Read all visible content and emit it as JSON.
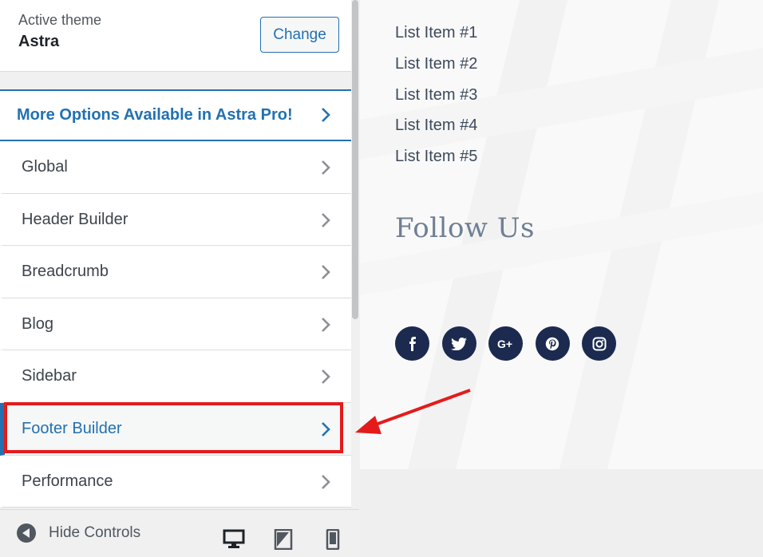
{
  "theme": {
    "label": "Active theme",
    "name": "Astra",
    "change_label": "Change"
  },
  "menu": {
    "pro_label": "More Options Available in Astra Pro!",
    "items": [
      {
        "label": "Global"
      },
      {
        "label": "Header Builder"
      },
      {
        "label": "Breadcrumb"
      },
      {
        "label": "Blog"
      },
      {
        "label": "Sidebar"
      },
      {
        "label": "Footer Builder"
      },
      {
        "label": "Performance"
      }
    ],
    "active_item": "Footer Builder"
  },
  "footer": {
    "hide_controls": "Hide Controls",
    "devices": [
      "desktop-icon",
      "tablet-icon",
      "mobile-icon"
    ]
  },
  "preview": {
    "list": [
      "List Item #1",
      "List Item #2",
      "List Item #3",
      "List Item #4",
      "List Item #5"
    ],
    "follow_title": "Follow Us",
    "socials": [
      "facebook-icon",
      "twitter-icon",
      "google-plus-icon",
      "pinterest-icon",
      "instagram-icon"
    ]
  },
  "colors": {
    "accent": "#2271b1",
    "highlight": "#e41b1b",
    "social_bg": "#1b2a4e"
  }
}
